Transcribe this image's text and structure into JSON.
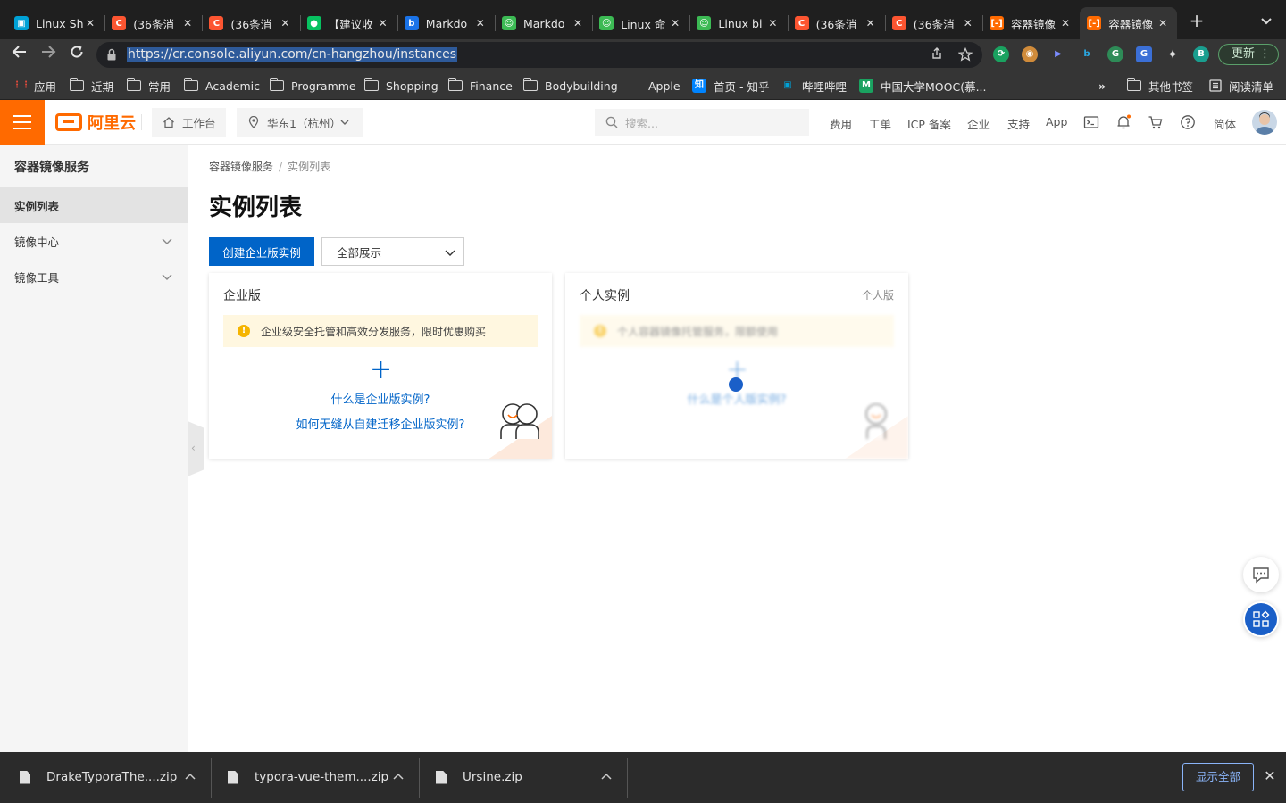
{
  "browser": {
    "tabs": [
      {
        "label": "Linux Sh",
        "icon": "bilibili-icon",
        "color": "#00a1d6"
      },
      {
        "label": "(36条消",
        "icon": "csdn-icon",
        "color": "#fc5531"
      },
      {
        "label": "(36条消",
        "icon": "csdn-icon",
        "color": "#fc5531"
      },
      {
        "label": "【建议收",
        "icon": "wechat-icon",
        "color": "#07c160"
      },
      {
        "label": "Markdo",
        "icon": "bing-icon",
        "color": "#1a73e8"
      },
      {
        "label": "Markdo",
        "icon": "robot-icon",
        "color": "#3cba54"
      },
      {
        "label": "Linux 命",
        "icon": "robot-icon",
        "color": "#3cba54"
      },
      {
        "label": "Linux bi",
        "icon": "robot-icon",
        "color": "#3cba54"
      },
      {
        "label": "(36条消",
        "icon": "csdn-icon",
        "color": "#fc5531"
      },
      {
        "label": "(36条消",
        "icon": "csdn-icon",
        "color": "#fc5531"
      },
      {
        "label": "容器镜像",
        "icon": "aliyun-icon",
        "color": "#ff6a00"
      },
      {
        "label": "容器镜像",
        "icon": "aliyun-icon",
        "color": "#ff6a00"
      }
    ],
    "url": "https://cr.console.aliyun.com/cn-hangzhou/instances",
    "update_label": "更新",
    "profile_initial": "B",
    "bookmarks": [
      {
        "label": "应用",
        "type": "apps"
      },
      {
        "label": "近期",
        "type": "folder"
      },
      {
        "label": "常用",
        "type": "folder"
      },
      {
        "label": "Academic",
        "type": "folder"
      },
      {
        "label": "Programme",
        "type": "folder"
      },
      {
        "label": "Shopping",
        "type": "folder"
      },
      {
        "label": "Finance",
        "type": "folder"
      },
      {
        "label": "Bodybuilding",
        "type": "folder"
      },
      {
        "label": "Apple",
        "type": "apple"
      },
      {
        "label": "首页 - 知乎",
        "type": "zhihu"
      },
      {
        "label": "哔哩哔哩",
        "type": "bilibili"
      },
      {
        "label": "中国大学MOOC(慕...",
        "type": "mooc"
      }
    ],
    "bookmarks_overflow": "»",
    "other_bookmarks": "其他书签",
    "reading_list": "阅读清单"
  },
  "header": {
    "logo_text": "阿里云",
    "workbench": "工作台",
    "region": "华东1（杭州）",
    "search_placeholder": "搜索...",
    "nav": [
      "费用",
      "工单",
      "ICP 备案",
      "企业",
      "支持",
      "App"
    ],
    "language": "简体",
    "notification_dot_color": "#ff6a00"
  },
  "sidebar": {
    "title": "容器镜像服务",
    "items": [
      {
        "label": "实例列表",
        "active": true
      },
      {
        "label": "镜像中心",
        "expandable": true
      },
      {
        "label": "镜像工具",
        "expandable": true
      }
    ]
  },
  "main": {
    "breadcrumb": [
      "容器镜像服务",
      "实例列表"
    ],
    "breadcrumb_sep": "/",
    "title": "实例列表",
    "create_button": "创建企业版实例",
    "filter_value": "全部展示",
    "cards": [
      {
        "title": "企业版",
        "tag": "",
        "notice": "企业级安全托管和高效分发服务，限时优惠购买",
        "links": [
          "什么是企业版实例?",
          "如何无缝从自建迁移企业版实例?"
        ],
        "disabled": false
      },
      {
        "title": "个人实例",
        "tag": "个人版",
        "notice": "个人容器镜像托管服务，限额使用",
        "links": [
          "什么是个人版实例?"
        ],
        "disabled": true
      }
    ],
    "accent_color": "#0064c8"
  },
  "downloads": {
    "items": [
      "DrakeTyporaThe....zip",
      "typora-vue-them....zip",
      "Ursine.zip"
    ],
    "show_all": "显示全部"
  }
}
